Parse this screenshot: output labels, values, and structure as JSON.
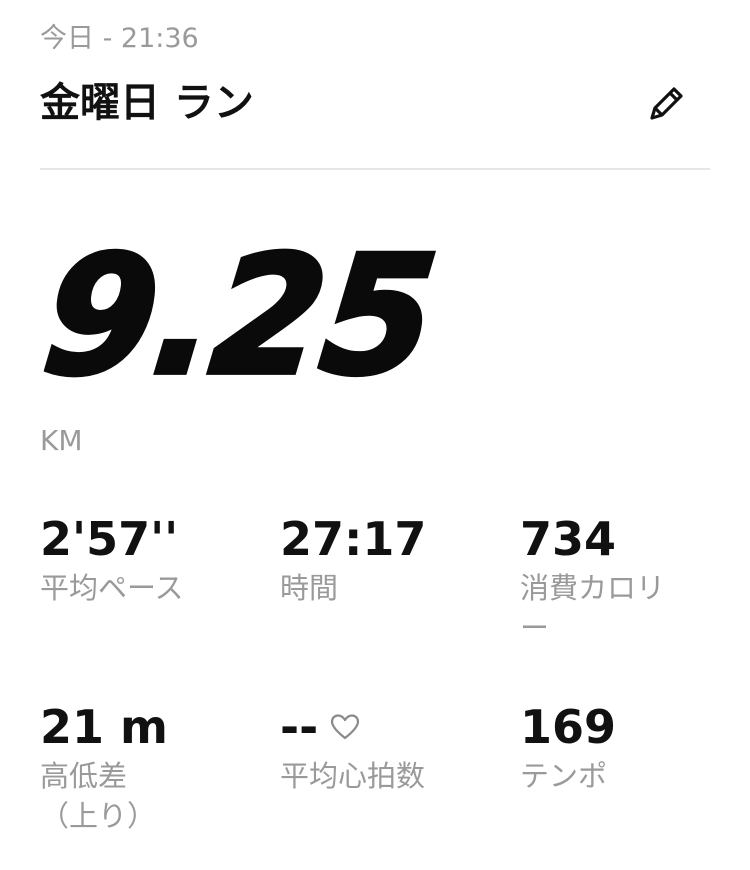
{
  "header": {
    "date": "今日 - 21:36",
    "title": "金曜日 ラン",
    "edit_icon": "pencil-icon"
  },
  "summary": {
    "distance": "9.25",
    "unit": "KM"
  },
  "stats": [
    {
      "value": "2'57''",
      "label": "平均ペース"
    },
    {
      "value": "27:17",
      "label": "時間"
    },
    {
      "value": "734",
      "label": "消費カロリー"
    },
    {
      "value": "21 m",
      "label": "高低差（上り）"
    },
    {
      "value": "--",
      "label": "平均心拍数",
      "icon": "heart-icon"
    },
    {
      "value": "169",
      "label": "テンポ"
    }
  ],
  "colors": {
    "text": "#111111",
    "secondary": "#9a9a9a",
    "divider": "#e6e6e6"
  }
}
